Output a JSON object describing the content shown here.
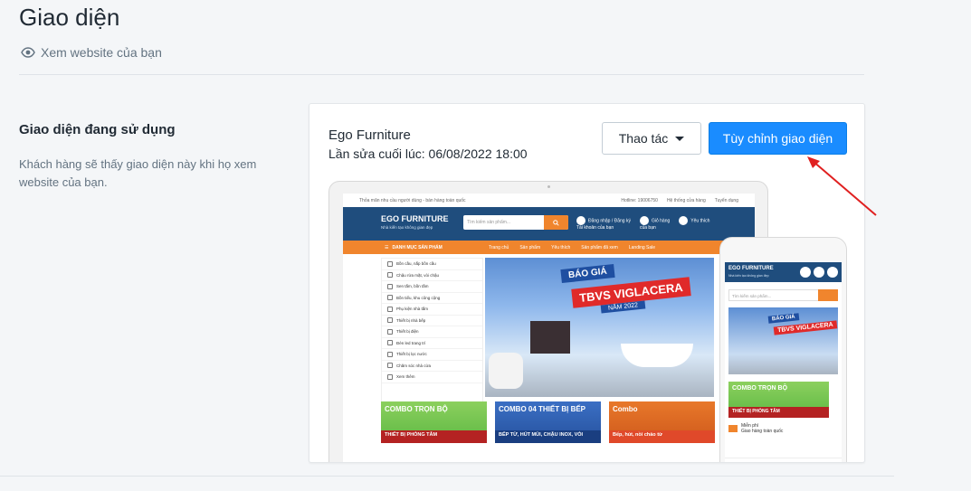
{
  "page": {
    "title": "Giao diện",
    "view_site_label": "Xem website của bạn"
  },
  "section": {
    "title": "Giao diện đang sử dụng",
    "description": "Khách hàng sẽ thấy giao diện này khi họ xem website của bạn."
  },
  "theme": {
    "name": "Ego Furniture",
    "last_edited": "Lần sửa cuối lúc: 06/08/2022 18:00",
    "actions_label": "Thao tác",
    "customize_label": "Tùy chỉnh giao diện",
    "accent_color": "#1a8cff"
  },
  "preview": {
    "topbar_left": "Thỏa mãn nhu cầu người dùng - bán hàng toàn quốc",
    "topbar_hotline": "Hotline: 19006750",
    "topbar_stores": "Hệ thống cửa hàng",
    "topbar_jobs": "Tuyển dụng",
    "logo": "EGO FURNITURE",
    "logo_tagline": "Nhà kiến tạo không gian đẹp",
    "search_placeholder": "Tìm kiếm sản phẩm...",
    "account_label": "Đăng nhập / Đăng ký",
    "account_sub": "Tài khoản của bạn",
    "cart_label": "Giỏ hàng",
    "cart_sub": "của bạn",
    "wishlist_label": "Yêu thích",
    "nav_categories": "DANH MỤC SẢN PHẨM",
    "nav_items": [
      "Trang chủ",
      "Sản phẩm",
      "Yêu thích",
      "Sản phẩm đã xem",
      "Landing Sale"
    ],
    "categories": [
      "Bồn cầu, nắp bồn cầu",
      "Chậu rửa mặt, vòi chậu",
      "Sen tắm, bồn tắm",
      "Bồn tiểu, khu công cộng",
      "Phụ kiện nhà tắm",
      "Thiết bị nhà bếp",
      "Thiết bị điện",
      "Đèn led trang trí",
      "Thiết bị lọc nước",
      "Chăm sóc nhà cửa",
      "Xem thêm"
    ],
    "banner_line1": "BÁO GIÁ",
    "banner_line2": "TBVS VIGLACERA",
    "banner_line3": "NĂM 2022",
    "promo1_title": "COMBO TRỌN BỘ",
    "promo1_sub": "THIẾT BỊ PHÒNG TẮM",
    "promo2_title": "COMBO 04 THIẾT BỊ BẾP",
    "promo2_sub": "BẾP TỪ, HÚT MÙI, CHẬU INOX, VÒI",
    "promo3_title": "Combo",
    "promo3_sub": "Bếp, hút, nồi chảo từ",
    "phone_ship_label": "Miễn phí",
    "phone_ship_sub": "Giao hàng toàn quốc"
  }
}
